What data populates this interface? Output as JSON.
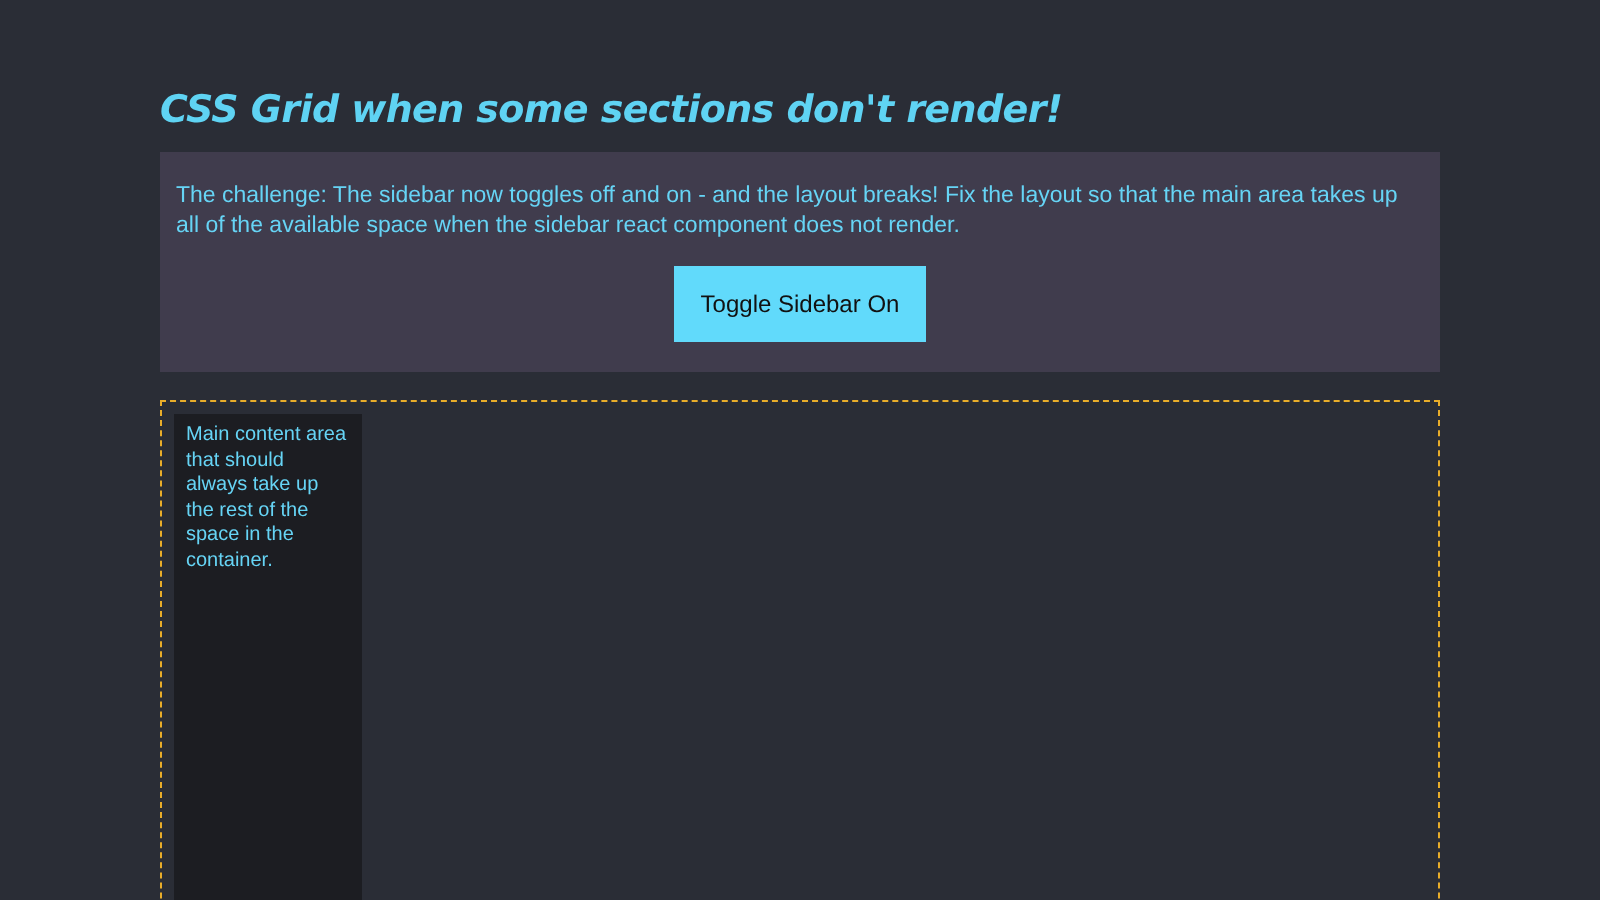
{
  "title": "CSS Grid when some sections don't render!",
  "challenge": {
    "text": "The challenge: The sidebar now toggles off and on - and the layout breaks! Fix the layout so that the main area takes up all of the available space when the sidebar react component does not render.",
    "button": "Toggle Sidebar On"
  },
  "container": {
    "main": "Main content area that should always take up the rest of the space in the container."
  }
}
